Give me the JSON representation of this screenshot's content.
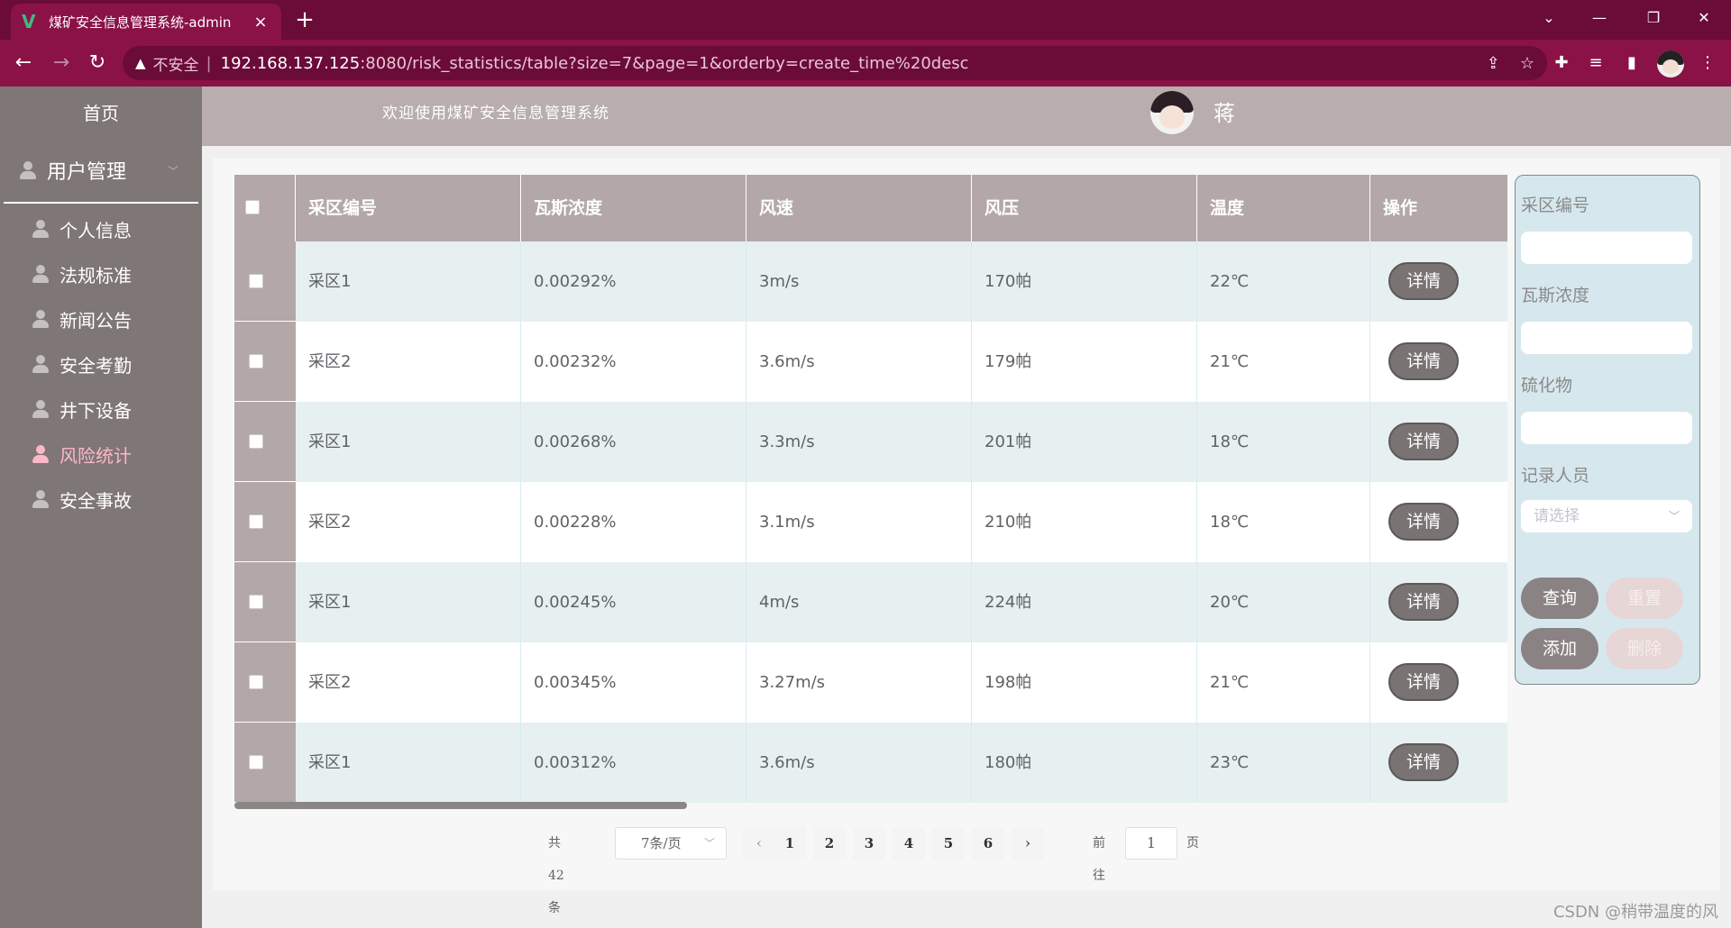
{
  "browser": {
    "tab_title": "煤矿安全信息管理系统-admin",
    "tab_close": "×",
    "new_tab": "+",
    "insecure_label": "不安全",
    "url_host": "192.168.137.125",
    "url_rest": ":8080/risk_statistics/table?size=7&page=1&orderby=create_time%20desc"
  },
  "sidebar": {
    "home": "首页",
    "group_label": "用户管理",
    "items": [
      {
        "label": "个人信息",
        "active": false
      },
      {
        "label": "法规标准",
        "active": false
      },
      {
        "label": "新闻公告",
        "active": false
      },
      {
        "label": "安全考勤",
        "active": false
      },
      {
        "label": "井下设备",
        "active": false
      },
      {
        "label": "风险统计",
        "active": true
      },
      {
        "label": "安全事故",
        "active": false
      }
    ]
  },
  "header": {
    "welcome": "欢迎使用煤矿安全信息管理系统",
    "user_name": "蒋"
  },
  "table": {
    "columns": [
      "采区编号",
      "瓦斯浓度",
      "风速",
      "风压",
      "温度",
      "操作"
    ],
    "detail_label": "详情",
    "rows": [
      [
        "采区1",
        "0.00292%",
        "3m/s",
        "170帕",
        "22℃"
      ],
      [
        "采区2",
        "0.00232%",
        "3.6m/s",
        "179帕",
        "21℃"
      ],
      [
        "采区1",
        "0.00268%",
        "3.3m/s",
        "201帕",
        "18℃"
      ],
      [
        "采区2",
        "0.00228%",
        "3.1m/s",
        "210帕",
        "18℃"
      ],
      [
        "采区1",
        "0.00245%",
        "4m/s",
        "224帕",
        "20℃"
      ],
      [
        "采区2",
        "0.00345%",
        "3.27m/s",
        "198帕",
        "21℃"
      ],
      [
        "采区1",
        "0.00312%",
        "3.6m/s",
        "180帕",
        "23℃"
      ]
    ]
  },
  "pagination": {
    "total": "共 42 条",
    "page_size": "7条/页",
    "pages": [
      "1",
      "2",
      "3",
      "4",
      "5",
      "6"
    ],
    "goto_label": "前往",
    "goto_value": "1",
    "page_suffix": "页"
  },
  "search": {
    "field1": "采区编号",
    "field2": "瓦斯浓度",
    "field3": "硫化物",
    "field4": "记录人员",
    "select_placeholder": "请选择",
    "query": "查询",
    "reset": "重置",
    "add": "添加",
    "delete": "删除"
  },
  "watermark": "CSDN @稍带温度的风"
}
